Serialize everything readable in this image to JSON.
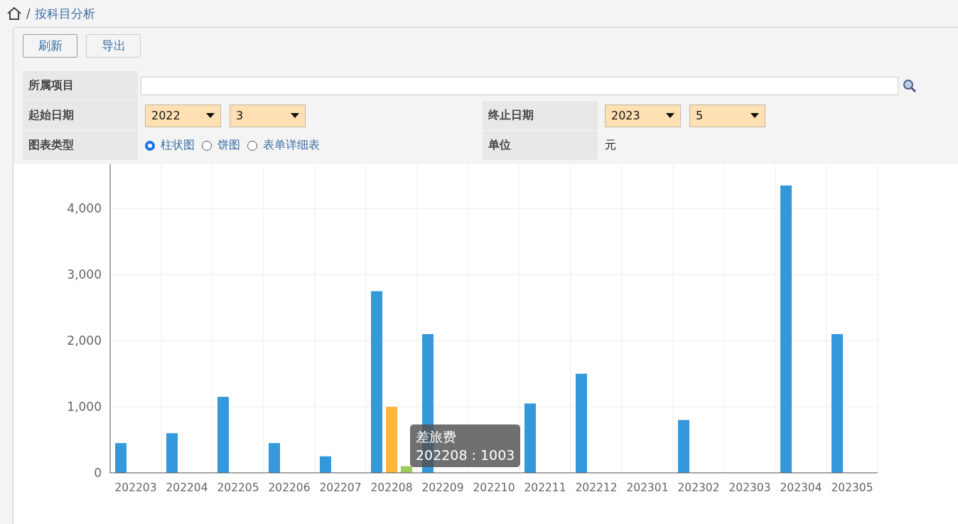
{
  "breadcrumb": {
    "separator": "/",
    "title": "按科目分析"
  },
  "buttons": [
    "刷新",
    "导出"
  ],
  "filters": {
    "project": {
      "label": "所属项目"
    },
    "start": {
      "label": "起始日期",
      "year": "2022",
      "month": "3"
    },
    "end": {
      "label": "终止日期",
      "year": "2023",
      "month": "5"
    },
    "chart_type": {
      "label": "图表类型",
      "options": [
        {
          "label": "柱状图",
          "selected": true
        },
        {
          "label": "饼图",
          "selected": false
        },
        {
          "label": "表单详细表",
          "selected": false
        }
      ]
    },
    "unit": {
      "label": "单位",
      "value": "元"
    }
  },
  "chart": {
    "chart_data": {
      "type": "bar",
      "grid": true,
      "categories": [
        "202203",
        "202204",
        "202205",
        "202206",
        "202207",
        "202208",
        "202209",
        "202210",
        "202211",
        "202212",
        "202301",
        "202302",
        "202303",
        "202304",
        "202305"
      ],
      "series": [
        {
          "color": "#3498db",
          "values": [
            450,
            600,
            1150,
            450,
            250,
            2750,
            2100,
            0,
            1050,
            1500,
            0,
            800,
            0,
            4350,
            2100
          ]
        },
        {
          "name": "差旅费",
          "color": "#ffb440",
          "values": [
            0,
            0,
            0,
            0,
            0,
            1000,
            0,
            0,
            0,
            0,
            0,
            0,
            0,
            0,
            0
          ]
        },
        {
          "color": "#9ccc5a",
          "values": [
            0,
            0,
            0,
            0,
            0,
            100,
            0,
            0,
            0,
            0,
            0,
            0,
            0,
            0,
            0
          ]
        }
      ],
      "ylim": [
        0,
        4650
      ],
      "yticks": [
        {
          "value": 0,
          "label": "0"
        },
        {
          "value": 1000,
          "label": "1,000"
        },
        {
          "value": 2000,
          "label": "2,000"
        },
        {
          "value": 3000,
          "label": "3,000"
        },
        {
          "value": 4000,
          "label": "4,000"
        }
      ]
    },
    "tooltip": {
      "text": "202208 : 1003"
    }
  }
}
